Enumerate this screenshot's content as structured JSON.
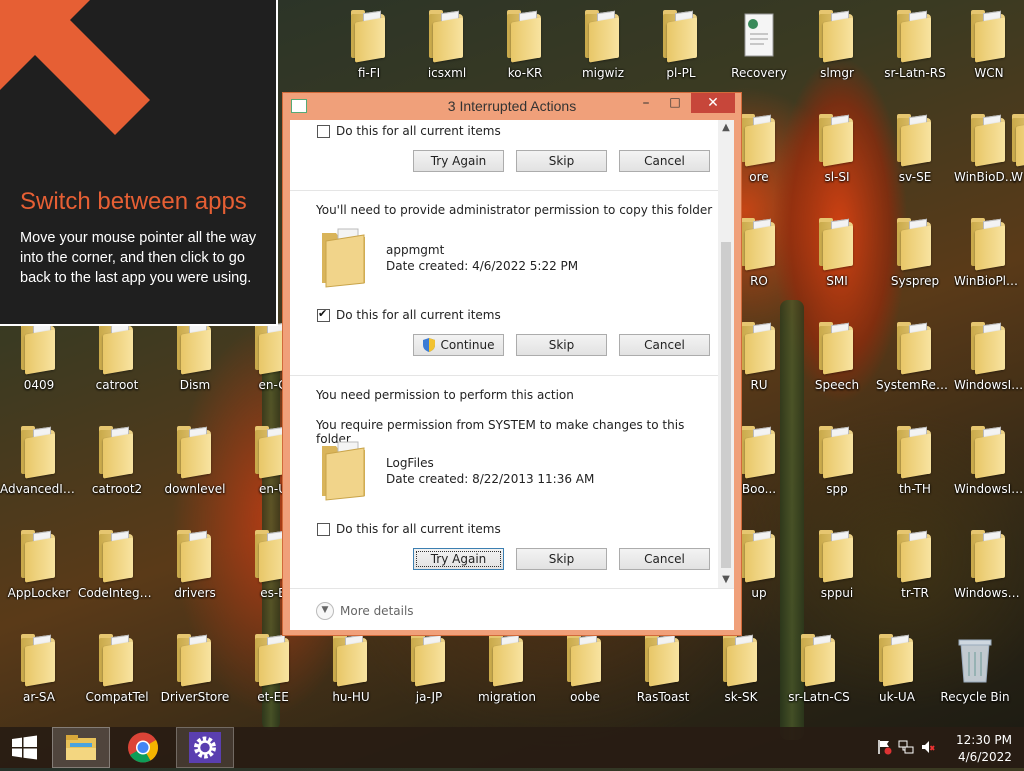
{
  "tip": {
    "title": "Switch between apps",
    "body": "Move your mouse pointer all the way into the corner, and then click to go back to the last app you were using."
  },
  "desktop": {
    "icons": [
      {
        "label": "fi-FI",
        "kind": "folder"
      },
      {
        "label": "icsxml",
        "kind": "folder"
      },
      {
        "label": "ko-KR",
        "kind": "folder"
      },
      {
        "label": "migwiz",
        "kind": "folder"
      },
      {
        "label": "pl-PL",
        "kind": "folder"
      },
      {
        "label": "Recovery",
        "kind": "document"
      },
      {
        "label": "slmgr",
        "kind": "folder"
      },
      {
        "label": "sr-Latn-RS",
        "kind": "folder"
      },
      {
        "label": "WCN",
        "kind": "folder"
      },
      {
        "label": "ore",
        "kind": "folder"
      },
      {
        "label": "sl-SI",
        "kind": "folder"
      },
      {
        "label": "sv-SE",
        "kind": "folder"
      },
      {
        "label": "WinBioDat...",
        "kind": "folder"
      },
      {
        "label": "W",
        "kind": "folder"
      },
      {
        "label": "RO",
        "kind": "folder"
      },
      {
        "label": "SMI",
        "kind": "folder"
      },
      {
        "label": "Sysprep",
        "kind": "folder"
      },
      {
        "label": "WinBioPlug...",
        "kind": "folder"
      },
      {
        "label": "0409",
        "kind": "folder"
      },
      {
        "label": "catroot",
        "kind": "folder"
      },
      {
        "label": "Dism",
        "kind": "folder"
      },
      {
        "label": "en-G",
        "kind": "folder"
      },
      {
        "label": "RU",
        "kind": "folder"
      },
      {
        "label": "Speech",
        "kind": "folder"
      },
      {
        "label": "SystemRese...",
        "kind": "folder"
      },
      {
        "label": "WindowsInt...",
        "kind": "folder"
      },
      {
        "label": "AdvancedIn...",
        "kind": "folder"
      },
      {
        "label": "catroot2",
        "kind": "folder"
      },
      {
        "label": "downlevel",
        "kind": "folder"
      },
      {
        "label": "en-U",
        "kind": "folder"
      },
      {
        "label": "Boo...",
        "kind": "folder"
      },
      {
        "label": "spp",
        "kind": "folder"
      },
      {
        "label": "th-TH",
        "kind": "folder"
      },
      {
        "label": "WindowsInt...",
        "kind": "folder"
      },
      {
        "label": "AppLocker",
        "kind": "folder"
      },
      {
        "label": "CodeIntegrity",
        "kind": "folder"
      },
      {
        "label": "drivers",
        "kind": "folder"
      },
      {
        "label": "es-E",
        "kind": "folder"
      },
      {
        "label": "up",
        "kind": "folder"
      },
      {
        "label": "sppui",
        "kind": "folder"
      },
      {
        "label": "tr-TR",
        "kind": "folder"
      },
      {
        "label": "WindowsPo...",
        "kind": "folder"
      },
      {
        "label": "ar-SA",
        "kind": "folder"
      },
      {
        "label": "CompatTel",
        "kind": "folder"
      },
      {
        "label": "DriverStore",
        "kind": "folder"
      },
      {
        "label": "et-EE",
        "kind": "folder"
      },
      {
        "label": "hu-HU",
        "kind": "folder"
      },
      {
        "label": "ja-JP",
        "kind": "folder"
      },
      {
        "label": "migration",
        "kind": "folder"
      },
      {
        "label": "oobe",
        "kind": "folder"
      },
      {
        "label": "RasToast",
        "kind": "folder"
      },
      {
        "label": "sk-SK",
        "kind": "folder"
      },
      {
        "label": "sr-Latn-CS",
        "kind": "folder"
      },
      {
        "label": "uk-UA",
        "kind": "folder"
      },
      {
        "label": "Recycle Bin",
        "kind": "recycle-bin"
      }
    ]
  },
  "dialog": {
    "title": "3 Interrupted Actions",
    "section1": {
      "checkbox_label": "Do this for all current items",
      "checked": false,
      "buttons": [
        "Try Again",
        "Skip",
        "Cancel"
      ]
    },
    "section2": {
      "message": "You'll need to provide administrator permission to copy this folder",
      "file_name": "appmgmt",
      "file_date": "Date created: 4/6/2022 5:22 PM",
      "checkbox_label": "Do this for all current items",
      "checked": true,
      "buttons": [
        "Continue",
        "Skip",
        "Cancel"
      ]
    },
    "section3": {
      "message": "You need permission to perform this action",
      "detail": "You require permission from SYSTEM to make changes to this folder",
      "file_name": "LogFiles",
      "file_date": "Date created: 8/22/2013 11:36 AM",
      "checkbox_label": "Do this for all current items",
      "checked": false,
      "buttons": [
        "Try Again",
        "Skip",
        "Cancel"
      ]
    },
    "more_details": "More details"
  },
  "taskbar": {
    "apps": [
      "start",
      "file-explorer",
      "chrome",
      "settings"
    ],
    "clock": {
      "time": "12:30 PM",
      "date": "4/6/2022"
    }
  },
  "colors": {
    "tip_accent": "#e65f34",
    "dialog_frame": "#f0a07a",
    "close_button": "#c7463a"
  }
}
